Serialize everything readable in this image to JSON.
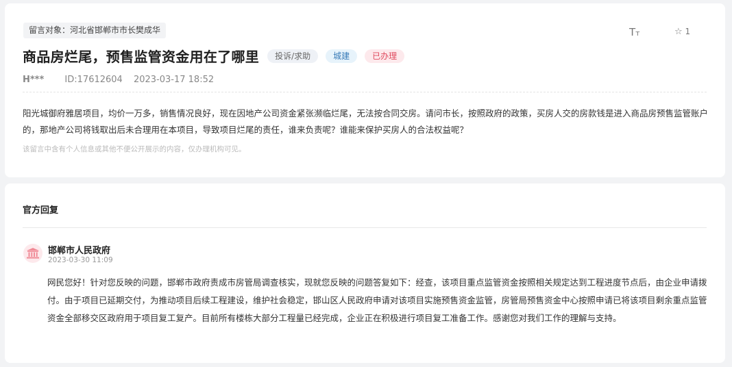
{
  "message": {
    "target_label": "留言对象：河北省邯郸市市长樊成华",
    "title": "商品房烂尾，预售监管资金用在了哪里",
    "tags": [
      "投诉/求助",
      "城建",
      "已办理"
    ],
    "font_toggle_label": "Tт",
    "star_count": "1",
    "user": "H***",
    "id_text": "ID:17612604",
    "datetime": "2023-03-17 18:52",
    "content": "阳光城御府雅居项目，均价一万多，销售情况良好，现在因地产公司资金紧张濒临烂尾，无法按合同交房。请问市长，按照政府的政策，买房人交的房款钱是进入商品房预售监管账户的，那地产公司将钱取出后未合理用在本项目，导致项目烂尾的责任，谁来负责呢？谁能来保护买房人的合法权益呢？",
    "privacy_notice": "该留言中含有个人信息或其他不便公开展示的内容，仅办理机构可见。"
  },
  "reply": {
    "header": "官方回复",
    "department": "邯郸市人民政府",
    "datetime": "2023-03-30 11:09",
    "content": "网民您好！针对您反映的问题，邯郸市政府责成市房管局调查核实，现就您反映的问题答复如下：经查，该项目重点监管资金按照相关规定达到工程进度节点后，由企业申请拨付。由于项目已延期交付，为推动项目后续工程建设，维护社会稳定，邯山区人民政府申请对该项目实施预售资金监管，房管局预售资金中心按照申请已将该项目剩余重点监管资金全部移交区政府用于项目复工复产。目前所有楼栋大部分工程量已经完成，企业正在积极进行项目复工准备工作。感谢您对我们工作的理解与支持。"
  },
  "icons": {
    "font_size": "font-size-icon",
    "star": "star-outline-icon",
    "government": "government-building-icon"
  },
  "colors": {
    "status_red": "#e04a5e",
    "category_blue": "#3a7cb8",
    "page_bg": "#f2f3f5"
  }
}
